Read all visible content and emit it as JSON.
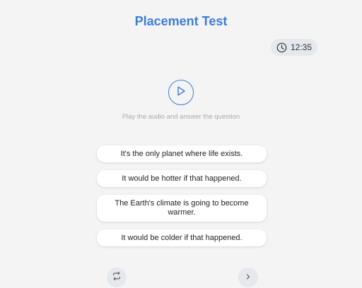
{
  "header": {
    "title": "Placement Test"
  },
  "timer": {
    "icon": "clock-icon",
    "time": "12:35"
  },
  "audio": {
    "play_icon": "play-icon",
    "instruction": "Play the audio and answer the question"
  },
  "options": [
    {
      "label": "It's the only planet where life exists."
    },
    {
      "label": "It would be hotter if that happened."
    },
    {
      "label": "The Earth's climate is going to become warmer."
    },
    {
      "label": "It would be colder if that happened."
    }
  ],
  "footer": {
    "repeat_icon": "repeat-icon",
    "next_icon": "chevron-right-icon"
  },
  "colors": {
    "accent": "#3b7dd8",
    "background": "#f4f4f4",
    "pill": "#e5e9ee"
  }
}
